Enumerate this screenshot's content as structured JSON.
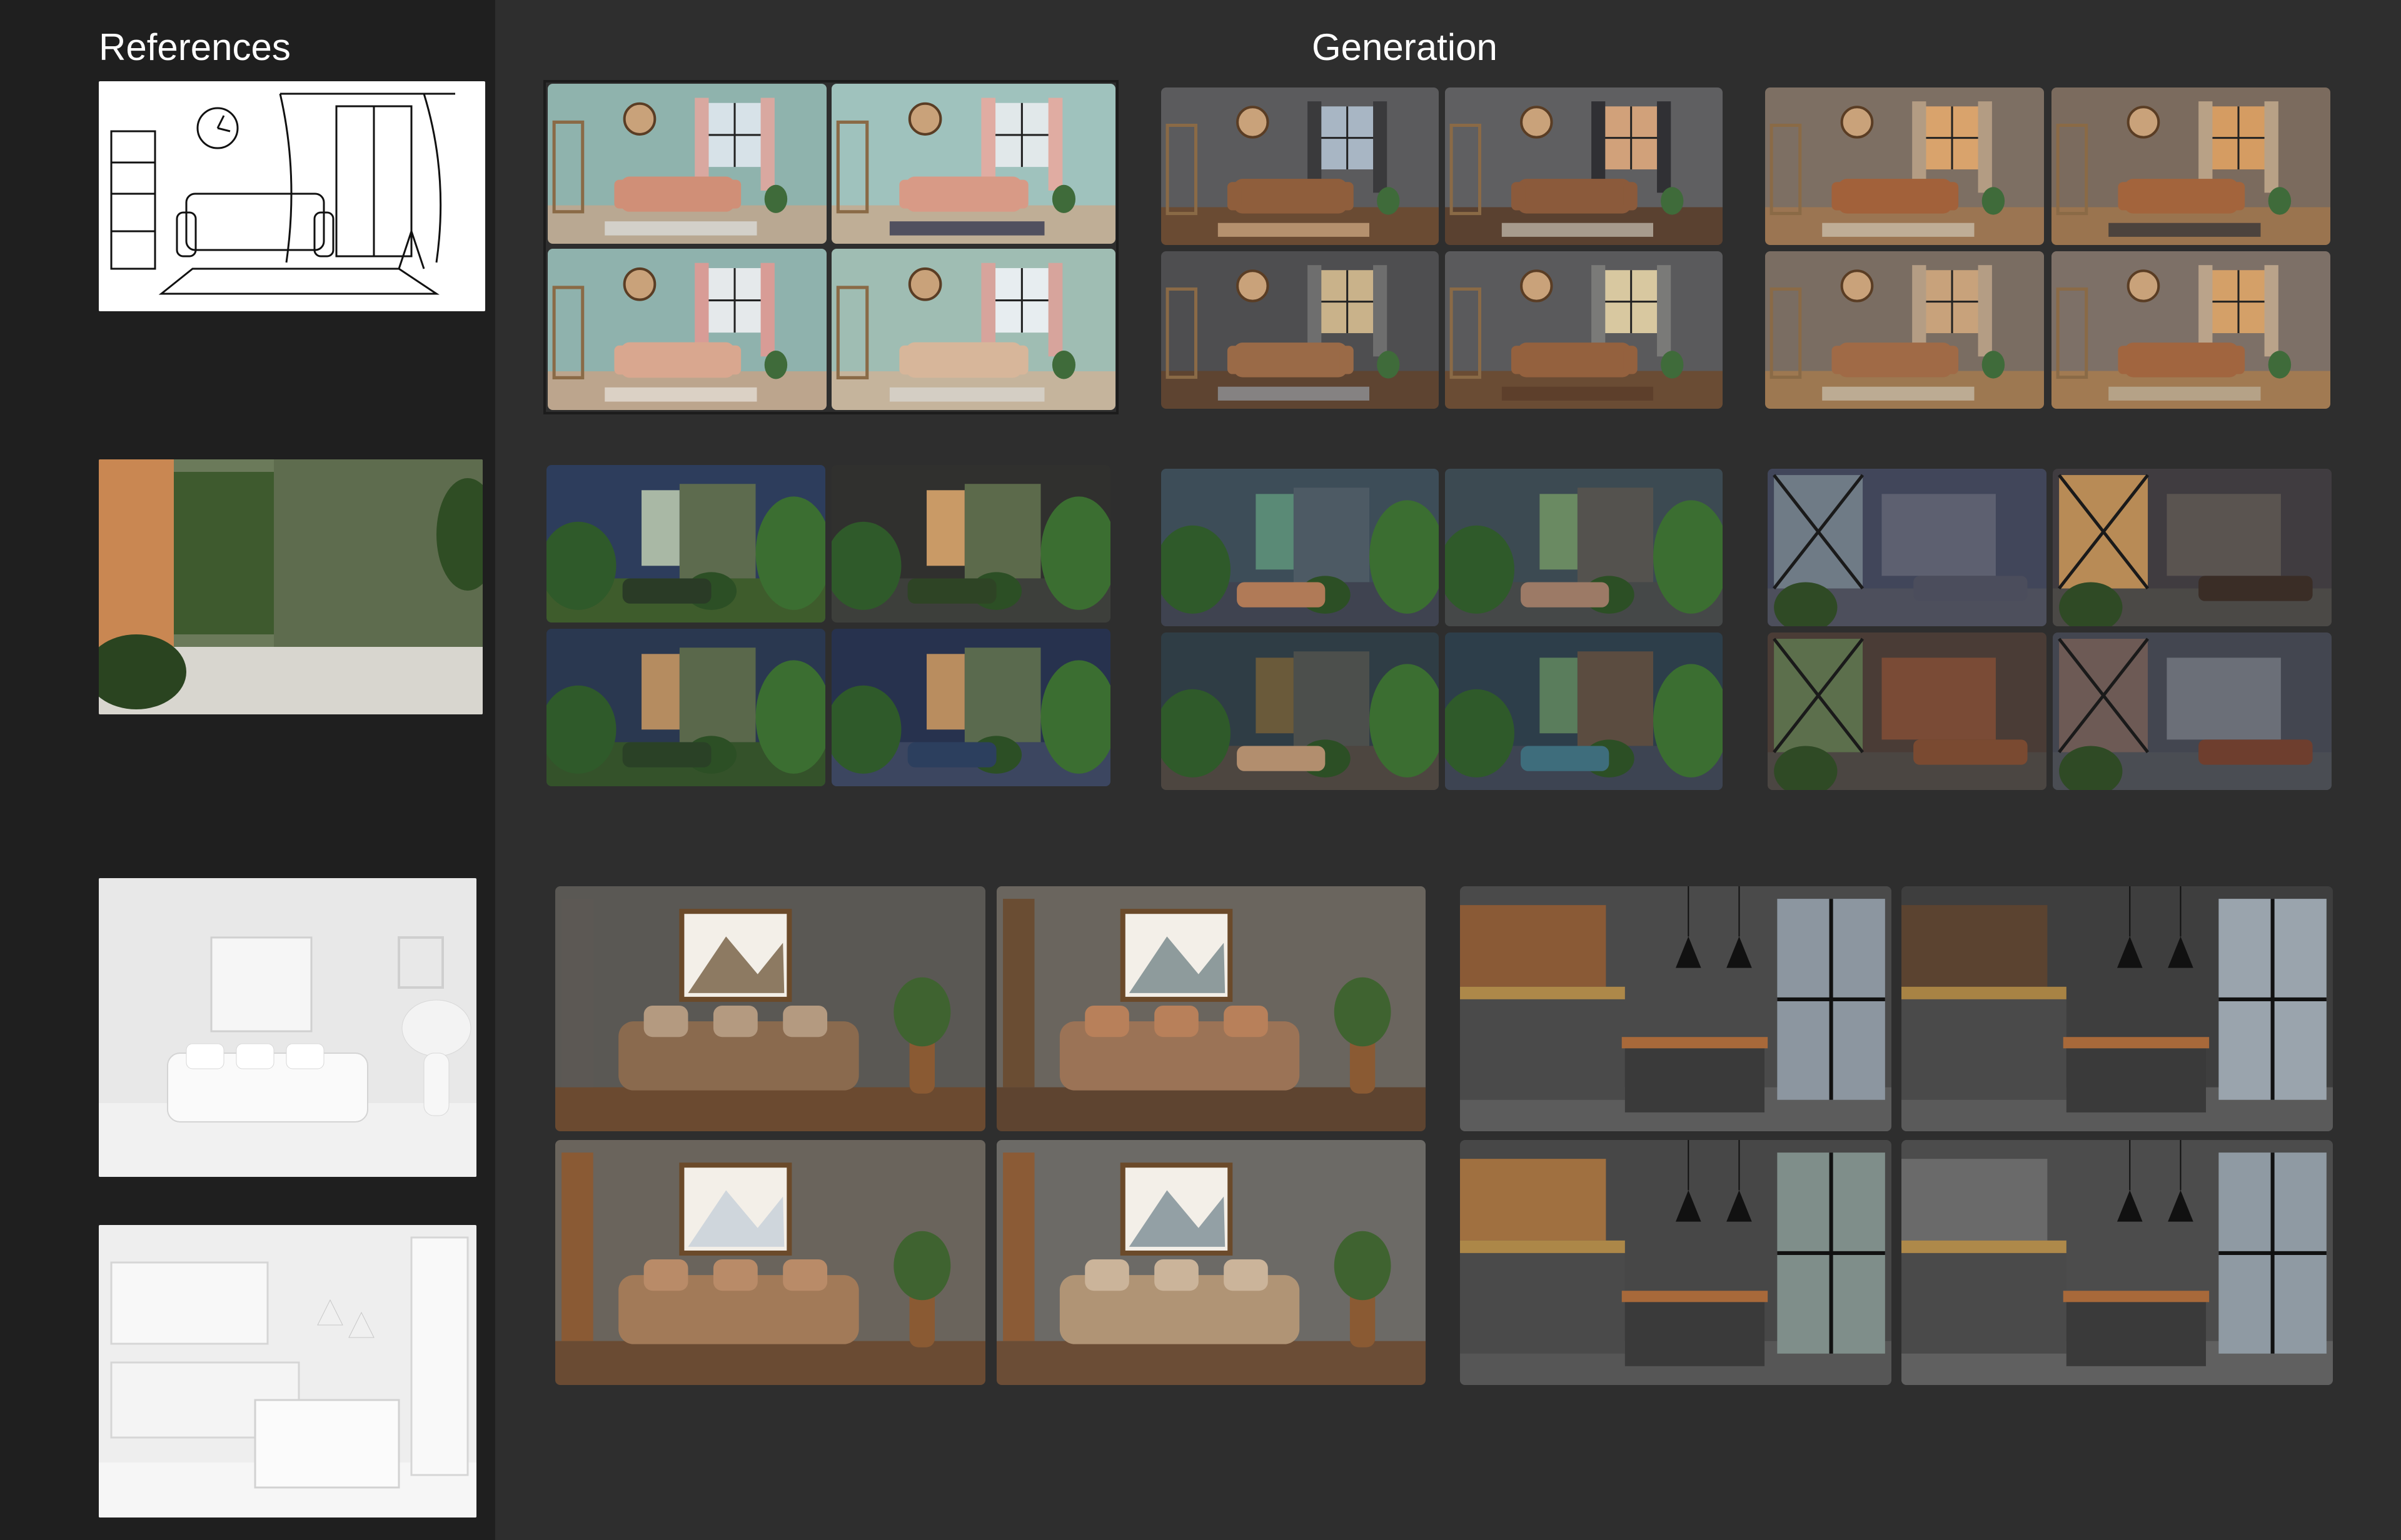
{
  "headings": {
    "references": "References",
    "generation": "Generation"
  },
  "palette": {
    "left_panel": "#1f1f1f",
    "right_panel": "#2e2e2e",
    "text": "#ffffff"
  },
  "references": [
    {
      "name": "reference-sketch-living-room",
      "style": "line-sketch"
    },
    {
      "name": "reference-entrance-green-wall",
      "style": "photo-green"
    },
    {
      "name": "reference-white-sofa-render",
      "style": "white-render"
    },
    {
      "name": "reference-white-kitchen-render",
      "style": "white-render-kitchen"
    }
  ],
  "generation_groups": [
    {
      "row": 1,
      "theme": "pastel-teal-living-room",
      "tiles": 4
    },
    {
      "row": 1,
      "theme": "grey-concrete-living-room",
      "tiles": 4
    },
    {
      "row": 1,
      "theme": "warm-beige-living-room",
      "tiles": 4
    },
    {
      "row": 2,
      "theme": "dark-blue-plant-corridor",
      "tiles": 4
    },
    {
      "row": 2,
      "theme": "teal-lounge-with-plants",
      "tiles": 4
    },
    {
      "row": 2,
      "theme": "industrial-loft",
      "tiles": 4
    },
    {
      "row": 3,
      "theme": "rustic-living-room-with-art",
      "tiles": 4
    },
    {
      "row": 3,
      "theme": "dark-grey-kitchen",
      "tiles": 4
    }
  ]
}
